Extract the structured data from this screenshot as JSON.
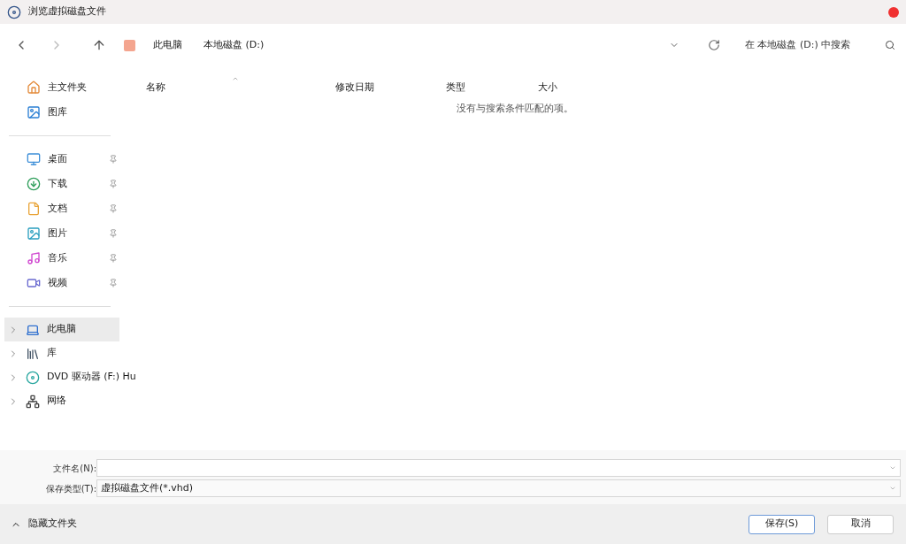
{
  "window": {
    "title": "浏览虚拟磁盘文件"
  },
  "toolbar": {
    "breadcrumbs": [
      "此电脑",
      "本地磁盘 (D:)"
    ],
    "search": {
      "placeholder": "在 本地磁盘 (D:) 中搜索"
    }
  },
  "sidebar": {
    "top": [
      {
        "label": "主文件夹",
        "kind": "home"
      },
      {
        "label": "图库",
        "kind": "gallery"
      }
    ],
    "pinned": [
      {
        "label": "桌面",
        "kind": "desktop"
      },
      {
        "label": "下载",
        "kind": "download"
      },
      {
        "label": "文档",
        "kind": "document"
      },
      {
        "label": "图片",
        "kind": "picture"
      },
      {
        "label": "音乐",
        "kind": "music"
      },
      {
        "label": "视频",
        "kind": "video"
      }
    ],
    "tree": [
      {
        "label": "此电脑",
        "kind": "pc",
        "selected": true
      },
      {
        "label": "库",
        "kind": "library",
        "selected": false
      },
      {
        "label": "DVD 驱动器 (F:) Hu",
        "kind": "dvd",
        "selected": false
      },
      {
        "label": "网络",
        "kind": "network",
        "selected": false
      }
    ]
  },
  "table": {
    "columns": [
      "名称",
      "修改日期",
      "类型",
      "大小"
    ],
    "empty_message": "没有与搜索条件匹配的项。"
  },
  "form": {
    "filename": {
      "label": "文件名(N):"
    },
    "filetype": {
      "label": "保存类型(T):",
      "value": "虚拟磁盘文件(*.vhd)"
    }
  },
  "footer": {
    "toggle": "隐藏文件夹",
    "buttons": [
      "保存(S)",
      "取消"
    ]
  }
}
